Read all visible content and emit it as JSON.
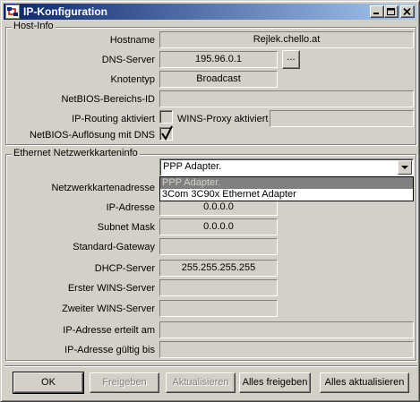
{
  "window": {
    "title": "IP-Konfiguration",
    "title_color": "#0a246a",
    "icon": "network-config-icon"
  },
  "host_info": {
    "legend": "Host-Info",
    "hostname_label": "Hostname",
    "hostname_value": "Rejlek.chello.at",
    "dns_label": "DNS-Server",
    "dns_value": "195.96.0.1",
    "dns_more_label": "...",
    "node_type_label": "Knotentyp",
    "node_type_value": "Broadcast",
    "netbios_scope_label": "NetBIOS-Bereichs-ID",
    "netbios_scope_value": "",
    "ip_routing_label": "IP-Routing aktiviert",
    "ip_routing_checked": false,
    "wins_proxy_label": "WINS-Proxy aktiviert",
    "wins_proxy_value": "",
    "netbios_dns_label": "NetBIOS-Auflösung mit DNS",
    "netbios_dns_checked": true
  },
  "adapter": {
    "legend": "Ethernet  Netzwerkkarteninfo",
    "selected": "PPP Adapter.",
    "options": [
      "PPP Adapter.",
      "3Com 3C90x Ethernet Adapter"
    ],
    "fields": [
      {
        "label": "Netzwerkkartenadresse",
        "value": ""
      },
      {
        "label": "IP-Adresse",
        "value": "0.0.0.0"
      },
      {
        "label": "Subnet Mask",
        "value": "0.0.0.0"
      },
      {
        "label": "Standard-Gateway",
        "value": ""
      },
      {
        "label": "DHCP-Server",
        "value": "255.255.255.255"
      },
      {
        "label": "Erster WINS-Server",
        "value": ""
      },
      {
        "label": "Zweiter WINS-Server",
        "value": ""
      },
      {
        "label": "IP-Adresse erteilt am",
        "value": ""
      },
      {
        "label": "IP-Adresse gültig bis",
        "value": ""
      }
    ]
  },
  "buttons": {
    "ok": "OK",
    "release": "Freigeben",
    "renew": "Aktualisieren",
    "release_all": "Alles freigeben",
    "renew_all": "Alles aktualisieren"
  }
}
